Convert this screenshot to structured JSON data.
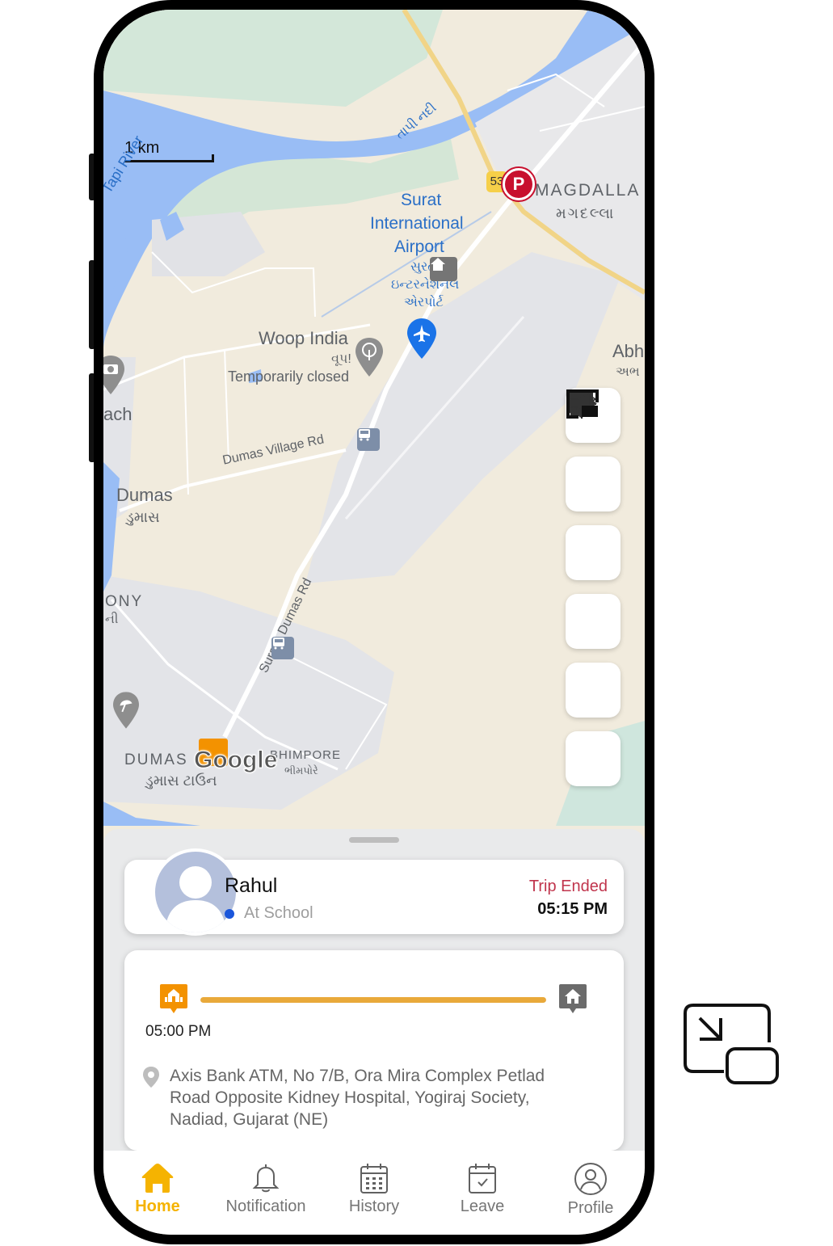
{
  "map": {
    "scale_label": "1 km",
    "labels": {
      "tapi_river": "Tapi River",
      "tapi_river_gujarati": "તાપી નદી",
      "airport_en_1": "Surat",
      "airport_en_2": "International",
      "airport_en_3": "Airport",
      "airport_gu_1": "સુરત",
      "airport_gu_2": "ઇન્ટરનેશનલ",
      "airport_gu_3": "એરપોર્ટ",
      "magdalla": "MAGDALLA",
      "magdalla_gu": "મગદલ્લા",
      "route_shield": "53",
      "woop_india": "Woop India",
      "woop_india_gu": "વૂપ!",
      "woop_status": "Temporarily closed",
      "abh": "Abh",
      "abh_gu": "અભ",
      "beach_partial": "ach",
      "dumas": "Dumas",
      "dumas_gu": "ડુમાસ",
      "dumas_village_rd": "Dumas Village Rd",
      "colony_partial": "ONY",
      "colony_gu_partial": "ની",
      "surat_dumas_rd": "Surat - Dumas Rd",
      "dumas_town": "DUMAS",
      "dumas_town_gu": "ડુમાસ ટાઉન",
      "bhimpore": "BHIMPORE",
      "bhimpore_gu": "ભીમપોરે",
      "google_logo": "Google"
    }
  },
  "fab_buttons": [
    {
      "name": "my-location",
      "icon": "crosshair-icon"
    },
    {
      "name": "home",
      "icon": "home-icon"
    },
    {
      "name": "layers",
      "icon": "layers-icon"
    },
    {
      "name": "message",
      "icon": "chat-bubble-icon"
    },
    {
      "name": "announcement",
      "icon": "megaphone-icon"
    },
    {
      "name": "picture-in-picture",
      "icon": "pip-icon"
    }
  ],
  "student_card": {
    "name": "Rahul",
    "status": "At School",
    "status_dot_color": "#1a56db",
    "trip_status": "Trip Ended",
    "trip_status_color": "#c0344c",
    "trip_time": "05:15 PM"
  },
  "trip_card": {
    "start_icon": "school-icon",
    "end_icon": "home-icon",
    "progress_percent": 100,
    "progress_color": "#e9a93a",
    "start_time": "05:00 PM",
    "address": "Axis Bank ATM, No 7/B, Ora Mira Complex Petlad Road Opposite Kidney Hospital, Yogiraj Society, Nadiad, Gujarat (NE)"
  },
  "bottom_nav": {
    "active_color": "#f5b301",
    "items": [
      {
        "label": "Home",
        "icon": "home-icon",
        "active": true
      },
      {
        "label": "Notification",
        "icon": "bell-icon",
        "active": false
      },
      {
        "label": "History",
        "icon": "calendar-grid-icon",
        "active": false
      },
      {
        "label": "Leave",
        "icon": "calendar-check-icon",
        "active": false
      },
      {
        "label": "Profile",
        "icon": "user-circle-icon",
        "active": false
      }
    ]
  },
  "external": {
    "pip_exit_icon": "exit-picture-in-picture-icon"
  }
}
